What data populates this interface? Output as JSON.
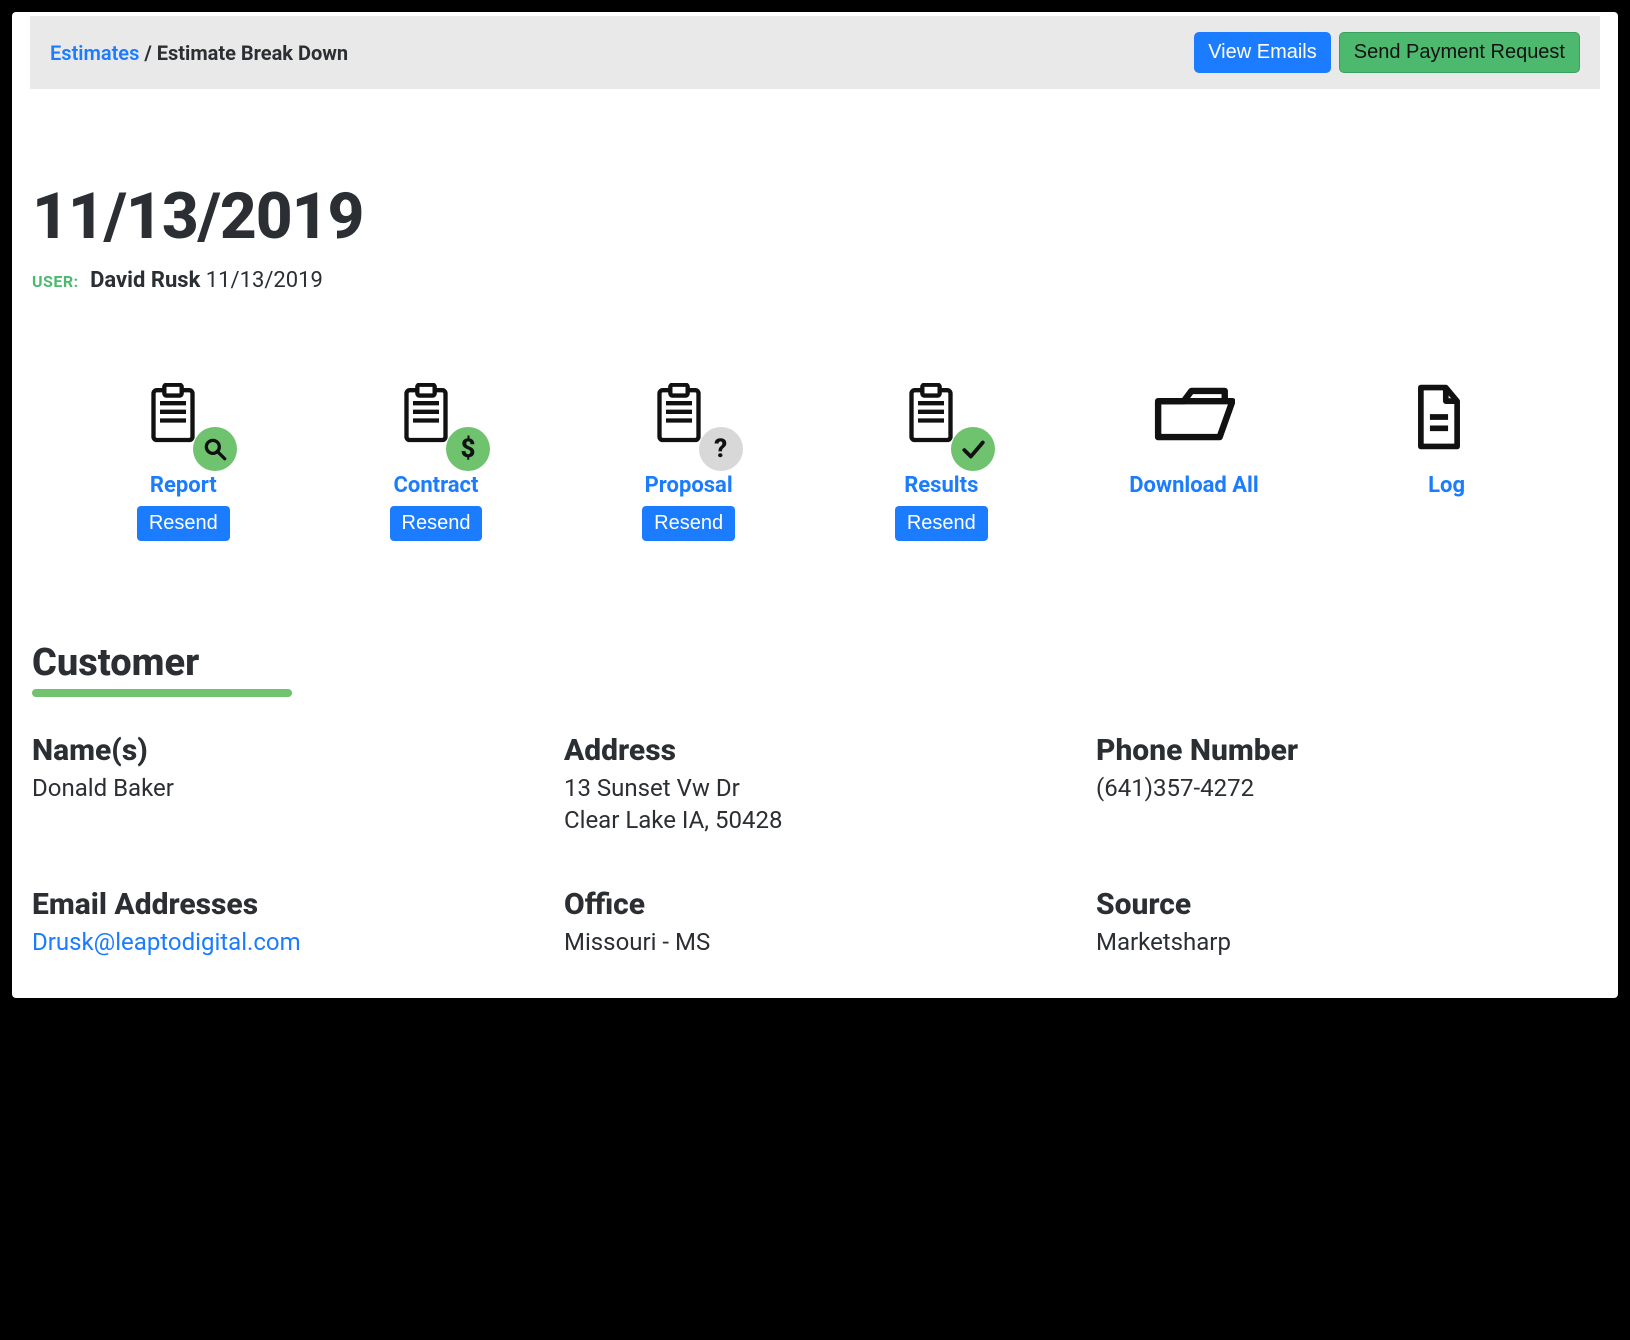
{
  "breadcrumb": {
    "root": "Estimates",
    "sep": " / ",
    "current": "Estimate Break Down"
  },
  "actions": {
    "view_emails": "View Emails",
    "send_payment": "Send Payment Request"
  },
  "header": {
    "date": "11/13/2019",
    "user_label": "USER:",
    "user_name": "David Rusk",
    "user_date": "11/13/2019"
  },
  "docs": {
    "report": {
      "label": "Report",
      "resend": "Resend"
    },
    "contract": {
      "label": "Contract",
      "resend": "Resend"
    },
    "proposal": {
      "label": "Proposal",
      "resend": "Resend"
    },
    "results": {
      "label": "Results",
      "resend": "Resend"
    },
    "download_all": {
      "label": "Download All"
    },
    "log": {
      "label": "Log"
    }
  },
  "customer": {
    "section_title": "Customer",
    "name_label": "Name(s)",
    "name_value": "Donald Baker",
    "address_label": "Address",
    "address_line1": "13 Sunset Vw Dr",
    "address_line2": "Clear Lake IA, 50428",
    "phone_label": "Phone Number",
    "phone_value": "(641)357-4272",
    "email_label": "Email Addresses",
    "email_value": "Drusk@leaptodigital.com",
    "office_label": "Office",
    "office_value": "Missouri - MS",
    "source_label": "Source",
    "source_value": "Marketsharp"
  }
}
